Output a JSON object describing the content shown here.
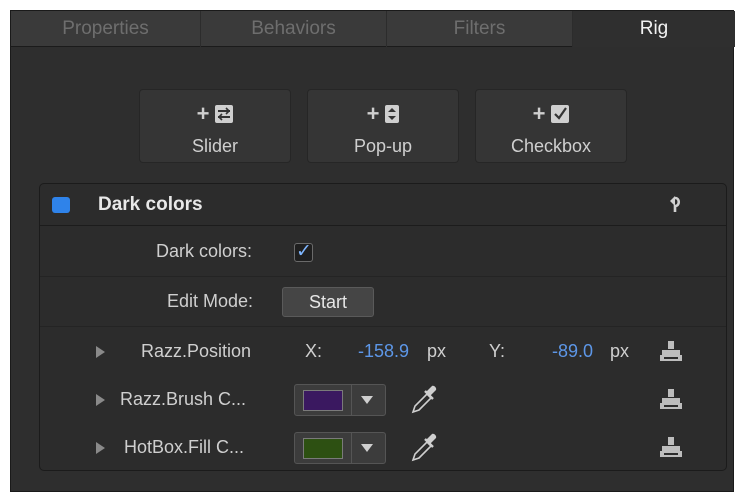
{
  "tabs": [
    {
      "label": "Properties",
      "active": false
    },
    {
      "label": "Behaviors",
      "active": false
    },
    {
      "label": "Filters",
      "active": false
    },
    {
      "label": "Rig",
      "active": true
    }
  ],
  "add_buttons": [
    {
      "plus": "+",
      "label": "Slider",
      "icon": "slider-icon"
    },
    {
      "plus": "+",
      "label": "Pop-up",
      "icon": "popup-icon"
    },
    {
      "plus": "+",
      "label": "Checkbox",
      "icon": "checkbox-icon"
    }
  ],
  "widget": {
    "title": "Dark colors",
    "enabled": true,
    "reset_icon": "reset-arrow-icon",
    "checkbox_row": {
      "label": "Dark colors:",
      "checked": true,
      "check_glyph": "✓"
    },
    "edit_mode": {
      "label": "Edit Mode:",
      "button": "Start"
    },
    "position_row": {
      "label": "Razz.Position",
      "x_label": "X:",
      "x_value": "-158.9",
      "x_unit": "px",
      "y_label": "Y:",
      "y_value": "-89.0",
      "y_unit": "px"
    },
    "color_rows": [
      {
        "label": "Razz.Brush C...",
        "color": "#3a1860"
      },
      {
        "label": "HotBox.Fill C...",
        "color": "#2d5012"
      }
    ]
  },
  "colors": {
    "accent_blue": "#2f83ea",
    "value_blue": "#5d97e8"
  }
}
